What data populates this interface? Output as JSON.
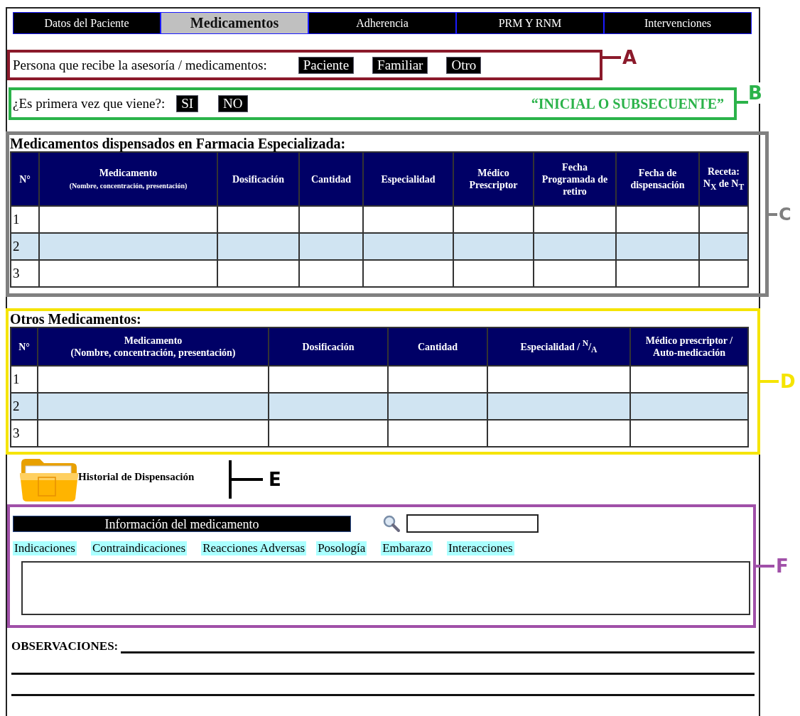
{
  "tabs": [
    {
      "label": "Datos del Paciente",
      "selected": false
    },
    {
      "label": "Medicamentos",
      "selected": true
    },
    {
      "label": "Adherencia",
      "selected": false
    },
    {
      "label": "PRM Y RNM",
      "selected": false
    },
    {
      "label": "Intervenciones",
      "selected": false
    }
  ],
  "recipient": {
    "label": "Persona que recibe la asesoría / medicamentos:",
    "options": [
      "Paciente",
      "Familiar",
      "Otro"
    ],
    "annotation": {
      "letter": "A",
      "color": "#8b1a2b"
    }
  },
  "first_visit": {
    "label": "¿Es primera vez que viene?:",
    "options": [
      "SI",
      "NO"
    ],
    "note": "“INICIAL O SUBSECUENTE”",
    "annotation": {
      "letter": "B",
      "color": "#2bb34a"
    }
  },
  "dispensed": {
    "title": "Medicamentos dispensados en Farmacia Especializada:",
    "annotation": {
      "letter": "C",
      "color": "#808080"
    },
    "columns": [
      {
        "label": "N°"
      },
      {
        "label": "Medicamento",
        "sublabel": "(Nombre, concentración, presentación)"
      },
      {
        "label": "Dosificación"
      },
      {
        "label": "Cantidad"
      },
      {
        "label": "Especialidad"
      },
      {
        "label": "Médico Prescriptor"
      },
      {
        "label": "Fecha Programada de retiro"
      },
      {
        "label": "Fecha de dispensación"
      },
      {
        "label": "Receta: N$_{X}$ de N$_{T}$"
      }
    ],
    "rows": [
      {
        "number": "1",
        "highlighted": false
      },
      {
        "number": "2",
        "highlighted": true
      },
      {
        "number": "3",
        "highlighted": false
      }
    ]
  },
  "other": {
    "title": "Otros Medicamentos:",
    "annotation": {
      "letter": "D",
      "color": "#f5e400"
    },
    "columns": [
      {
        "label": "N°"
      },
      {
        "label": "Medicamento",
        "sublabel": "(Nombre, concentración, presentación)"
      },
      {
        "label": "Dosificación"
      },
      {
        "label": "Cantidad"
      },
      {
        "label": "Especialidad /   $^{N}$/$_{A}$"
      },
      {
        "label": "Médico prescriptor / Auto-medicación"
      }
    ],
    "rows": [
      {
        "number": "1",
        "highlighted": false
      },
      {
        "number": "2",
        "highlighted": true
      },
      {
        "number": "3",
        "highlighted": false
      }
    ]
  },
  "history": {
    "label": "Historial de Dispensación",
    "annotation": {
      "letter": "E",
      "color": "#000000"
    }
  },
  "drug_info": {
    "title": "Información del medicamento",
    "annotation": {
      "letter": "F",
      "color": "#a050a8"
    },
    "tabs": [
      "Indicaciones",
      "Contraindicaciones",
      "Reacciones Adversas",
      "Posología",
      "Embarazo",
      "Interacciones"
    ]
  },
  "observations": {
    "label": "OBSERVACIONES:"
  }
}
